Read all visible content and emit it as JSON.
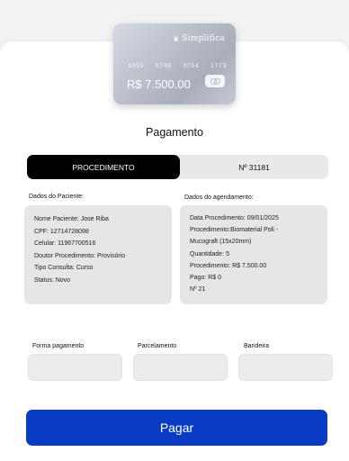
{
  "card": {
    "brand": "Simplifica",
    "number_groups": [
      "4563",
      "6748",
      "3754",
      "1773"
    ],
    "amount": "R$ 7.500.00"
  },
  "page_title": "Pagamento",
  "tabs": [
    {
      "label": "PROCEDIMENTO",
      "active": true
    },
    {
      "label": "Nº 31181",
      "active": false
    }
  ],
  "patient": {
    "heading": "Dados do Paciente:",
    "lines": [
      "Nome Paciente: Jose Riba",
      "CPF: 12714728098",
      "Celular: 11967700516",
      "Doutor Procedimento: Provisório",
      "Tipo Consulta: Curso",
      "Status: Novo"
    ]
  },
  "schedule": {
    "heading": "Dados do agendamento:",
    "lines": [
      "Data Procedimento: 09/01/2025",
      "Procedimento:Biomaterial Poli -",
      "Mucograft (15x20mm)",
      "Quantidade: 5",
      "Procedimento: R$ 7.500.00",
      "Pago: R$ 0",
      "Nº 21"
    ]
  },
  "fields": {
    "forma_pagamento": "Forma pagamento",
    "parcelamento": "Parcelamento",
    "bandeira": "Bandeira"
  },
  "pay_button": "Pagar",
  "colors": {
    "accent": "#0a3bc4",
    "tab_active": "#000000",
    "box_bg": "#e6e6e6"
  }
}
